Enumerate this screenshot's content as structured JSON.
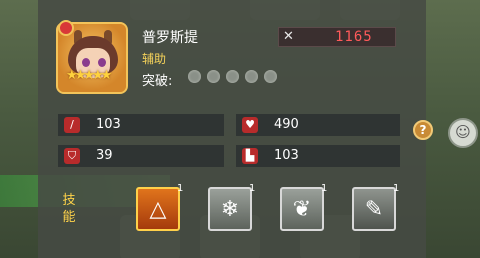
{
  "hero": {
    "name": "普罗斯提",
    "role": "辅助",
    "breakthrough_label": "突破:",
    "breakthrough_level": 0,
    "breakthrough_max": 5,
    "stars": "★★★★★",
    "star_count": 5
  },
  "power": {
    "icon": "crossed-swords-icon",
    "value": "1165",
    "color": "#ff5a5a"
  },
  "stats": {
    "attack": {
      "icon": "sword-icon",
      "value": "103"
    },
    "hp": {
      "icon": "heart-icon",
      "value": "490"
    },
    "defense": {
      "icon": "shield-icon",
      "value": "39"
    },
    "speed": {
      "icon": "boot-icon",
      "value": "103"
    }
  },
  "skills": {
    "label": "技能",
    "items": [
      {
        "icon": "warning-triangle-icon",
        "level": "1"
      },
      {
        "icon": "snowflake-icon",
        "level": "1"
      },
      {
        "icon": "wing-icon",
        "level": "1"
      },
      {
        "icon": "feather-icon",
        "level": "1"
      }
    ]
  },
  "colors": {
    "accent": "#f5d25a",
    "panel": "#464a44"
  }
}
